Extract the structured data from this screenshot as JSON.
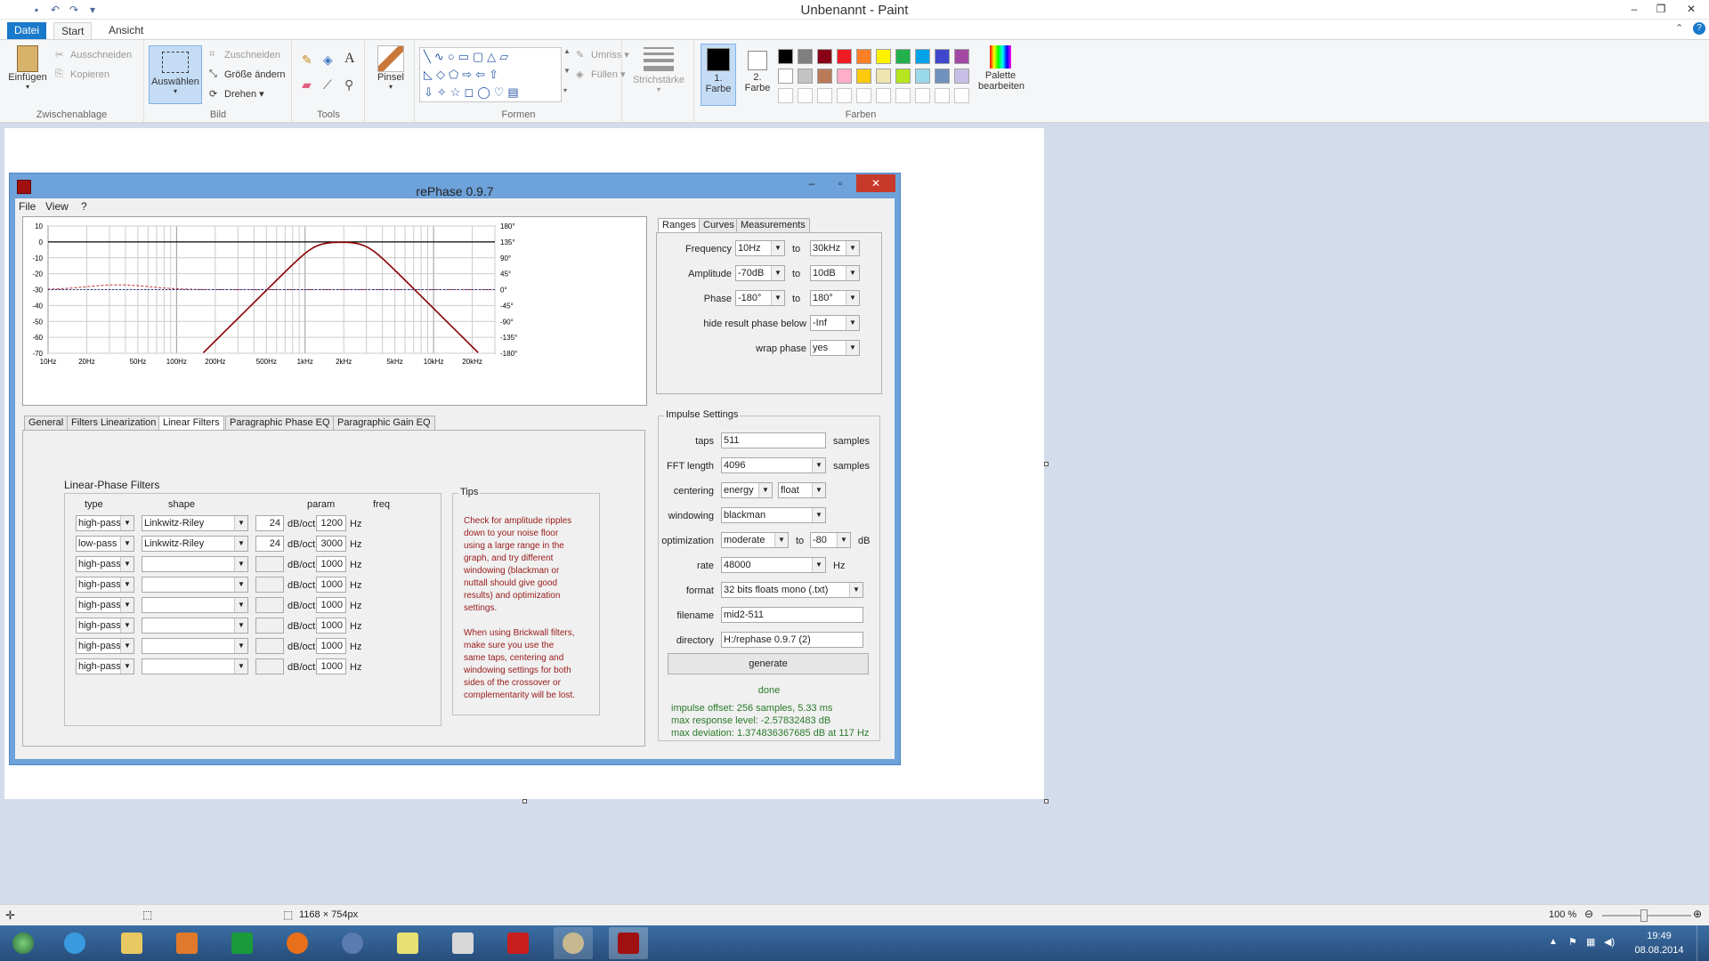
{
  "paint": {
    "title": "Unbenannt - Paint",
    "tabs": [
      "Datei",
      "Start",
      "Ansicht"
    ],
    "groups": {
      "clipboard": {
        "label": "Zwischenablage",
        "paste": "Einfügen",
        "cut": "Ausschneiden",
        "copy": "Kopieren"
      },
      "image": {
        "label": "Bild",
        "select": "Auswählen",
        "crop": "Zuschneiden",
        "resize": "Größe ändern",
        "rotate": "Drehen"
      },
      "tools": {
        "label": "Tools"
      },
      "brush": {
        "label": "Pinsel"
      },
      "shapes": {
        "label": "Formen",
        "outline": "Umriss",
        "fill": "Füllen"
      },
      "size": {
        "label": "Strichstärke"
      },
      "color1": {
        "label1": "1.",
        "label2": "Farbe"
      },
      "color2": {
        "label1": "2.",
        "label2": "Farbe"
      },
      "colors": {
        "label": "Farben",
        "edit1": "Palette",
        "edit2": "bearbeiten"
      }
    },
    "palette_row1": [
      "#000000",
      "#7f7f7f",
      "#880015",
      "#ed1c24",
      "#ff7f27",
      "#fff200",
      "#22b14c",
      "#00a2e8",
      "#3f48cc",
      "#a349a4"
    ],
    "palette_row2": [
      "#ffffff",
      "#c3c3c3",
      "#b97a57",
      "#ffaec9",
      "#ffc90e",
      "#efe4b0",
      "#b5e61d",
      "#99d9ea",
      "#7092be",
      "#c8bfe7"
    ],
    "status": {
      "size": "1168 × 754px",
      "zoom": "100 %"
    }
  },
  "rephase": {
    "title": "rePhase 0.9.7",
    "menu": [
      "File",
      "View",
      "?"
    ],
    "plot": {
      "y_left": [
        "10",
        "0",
        "-10",
        "-20",
        "-30",
        "-40",
        "-50",
        "-60",
        "-70"
      ],
      "y_right": [
        "180°",
        "135°",
        "90°",
        "45°",
        "0°",
        "-45°",
        "-90°",
        "-135°",
        "-180°"
      ],
      "x_ticks": [
        "10Hz",
        "20Hz",
        "50Hz",
        "100Hz",
        "200Hz",
        "500Hz",
        "1kHz",
        "2kHz",
        "5kHz",
        "10kHz",
        "20kHz"
      ]
    },
    "lower_tabs": [
      "General",
      "Filters Linearization",
      "Linear Filters",
      "Paragraphic Phase EQ",
      "Paragraphic Gain EQ"
    ],
    "filters": {
      "title": "Linear-Phase Filters",
      "headers": {
        "type": "type",
        "shape": "shape",
        "param": "param",
        "freq": "freq"
      },
      "unit_param": "dB/oct",
      "unit_freq": "Hz",
      "rows": [
        {
          "type": "high-pass",
          "shape": "Linkwitz-Riley",
          "param": "24",
          "freq": "1200"
        },
        {
          "type": "low-pass",
          "shape": "Linkwitz-Riley",
          "param": "24",
          "freq": "3000"
        },
        {
          "type": "high-pass",
          "shape": "",
          "param": "",
          "freq": "1000"
        },
        {
          "type": "high-pass",
          "shape": "",
          "param": "",
          "freq": "1000"
        },
        {
          "type": "high-pass",
          "shape": "",
          "param": "",
          "freq": "1000"
        },
        {
          "type": "high-pass",
          "shape": "",
          "param": "",
          "freq": "1000"
        },
        {
          "type": "high-pass",
          "shape": "",
          "param": "",
          "freq": "1000"
        },
        {
          "type": "high-pass",
          "shape": "",
          "param": "",
          "freq": "1000"
        }
      ]
    },
    "tips": {
      "title": "Tips",
      "p1": [
        "Check for amplitude ripples",
        "down to your noise floor",
        "using a large range in the",
        "graph, and try different",
        "windowing (blackman or",
        "nuttall should give good",
        "results) and optimization",
        "settings."
      ],
      "p2": [
        "When using Brickwall filters,",
        "make sure you use the",
        "same taps, centering and",
        "windowing settings for both",
        "sides of the crossover or",
        "complementarity will be lost."
      ]
    },
    "right_tabs": [
      "Ranges",
      "Curves",
      "Measurements"
    ],
    "ranges": {
      "frequency": {
        "label": "Frequency",
        "from": "10Hz",
        "to": "30kHz"
      },
      "amplitude": {
        "label": "Amplitude",
        "from": "-70dB",
        "to": "10dB"
      },
      "phase": {
        "label": "Phase",
        "from": "-180°",
        "to": "180°"
      },
      "to_label": "to",
      "hide": {
        "label": "hide result phase below",
        "value": "-Inf"
      },
      "wrap": {
        "label": "wrap phase",
        "value": "yes"
      }
    },
    "impulse": {
      "title": "Impulse Settings",
      "taps": {
        "label": "taps",
        "value": "511",
        "unit": "samples"
      },
      "fft": {
        "label": "FFT length",
        "value": "4096",
        "unit": "samples"
      },
      "centering": {
        "label": "centering",
        "value": "energy",
        "value2": "float"
      },
      "windowing": {
        "label": "windowing",
        "value": "blackman"
      },
      "optimization": {
        "label": "optimization",
        "value": "moderate",
        "to": "to",
        "value2": "-80",
        "unit": "dB"
      },
      "rate": {
        "label": "rate",
        "value": "48000",
        "unit": "Hz"
      },
      "format": {
        "label": "format",
        "value": "32 bits floats mono (.txt)"
      },
      "filename": {
        "label": "filename",
        "value": "mid2-511"
      },
      "directory": {
        "label": "directory",
        "value": "H:/rephase 0.9.7 (2)"
      },
      "generate": "generate",
      "done": "done",
      "info": [
        "impulse offset: 256 samples, 5.33 ms",
        "max response level: -2.57832483 dB",
        "max deviation: 1.374836367685 dB at 117 Hz"
      ]
    }
  },
  "taskbar": {
    "time": "19:49",
    "date": "08.08.2014"
  }
}
